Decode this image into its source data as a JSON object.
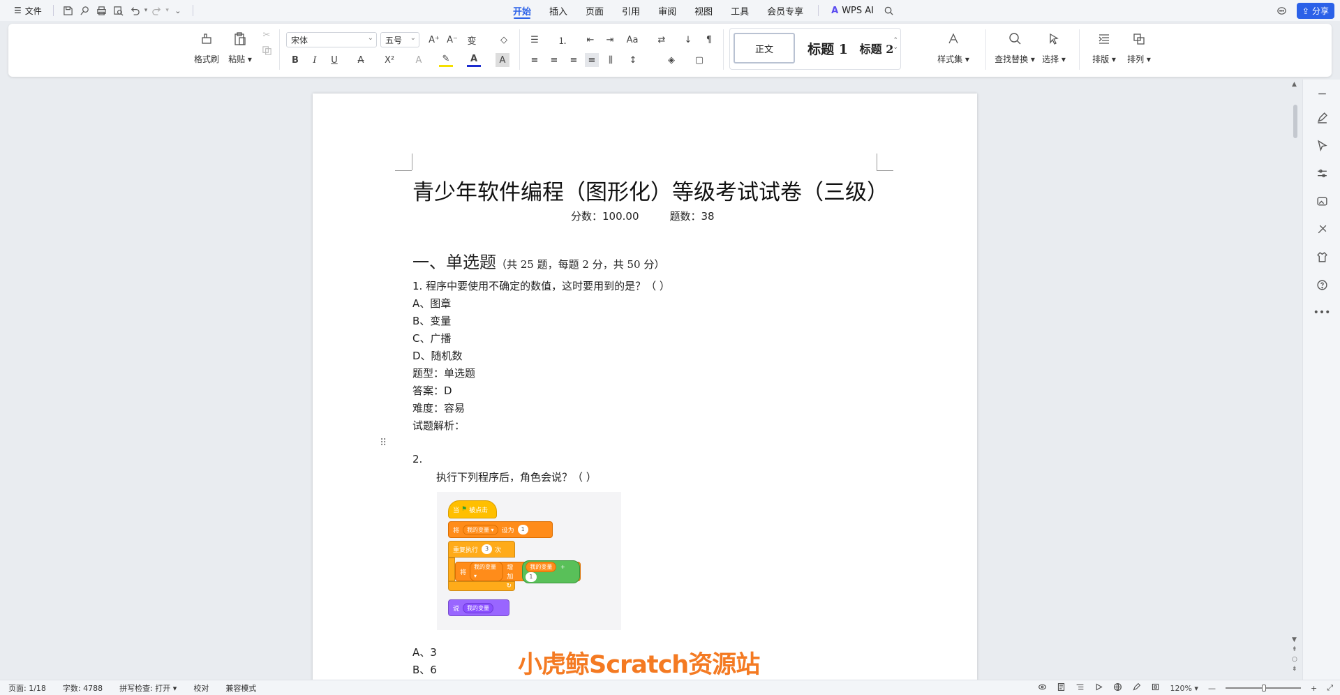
{
  "menubar": {
    "file_label": "文件",
    "tabs": [
      "开始",
      "插入",
      "页面",
      "引用",
      "审阅",
      "视图",
      "工具",
      "会员专享"
    ],
    "active_tab": "开始",
    "wps_ai_label": "WPS AI",
    "share_label": "分享"
  },
  "ribbon": {
    "format_painter": "格式刷",
    "paste": "粘贴",
    "font_name": "宋体",
    "font_size": "五号",
    "styles": {
      "normal": "正文",
      "h1": "标题 1",
      "h2": "标题 2"
    },
    "style_set": "样式集",
    "find_replace": "查找替换",
    "select": "选择",
    "layout": "排版",
    "arrange": "排列"
  },
  "doc": {
    "title": "青少年软件编程（图形化）等级考试试卷（三级）",
    "score": "分数：100.00",
    "count": "题数：38",
    "section_big": "一、单选题",
    "section_small": "（共 25 题，每题 2 分，共 50 分）",
    "q1": {
      "stem": "1. 程序中要使用不确定的数值，这时要用到的是？（ ）",
      "options": [
        "A、图章",
        "B、变量",
        "C、广播",
        "D、随机数"
      ],
      "type": "题型：单选题",
      "answer": "答案：D",
      "difficulty": "难度：容易",
      "analysis": "试题解析："
    },
    "q2": {
      "number": "2.",
      "stem": "执行下列程序后，角色会说？（ ）",
      "options": [
        "A、3",
        "B、6"
      ]
    },
    "scratch": {
      "when_flag": "当",
      "flag_clicked": "被点击",
      "set_prefix": "将",
      "var_name": "我的变量",
      "set_to": "设为",
      "set_value": "1",
      "repeat": "重复执行",
      "repeat_count": "3",
      "repeat_unit": "次",
      "change_prefix": "将",
      "change_by": "增加",
      "plus": "+",
      "plus_value": "1",
      "say": "说"
    }
  },
  "watermark": "小虎鲸Scratch资源站",
  "statusbar": {
    "page": "页面: 1/18",
    "words": "字数: 4788",
    "spell": "拼写检查: 打开",
    "proof": "校对",
    "compat": "兼容模式",
    "zoom": "120%"
  }
}
